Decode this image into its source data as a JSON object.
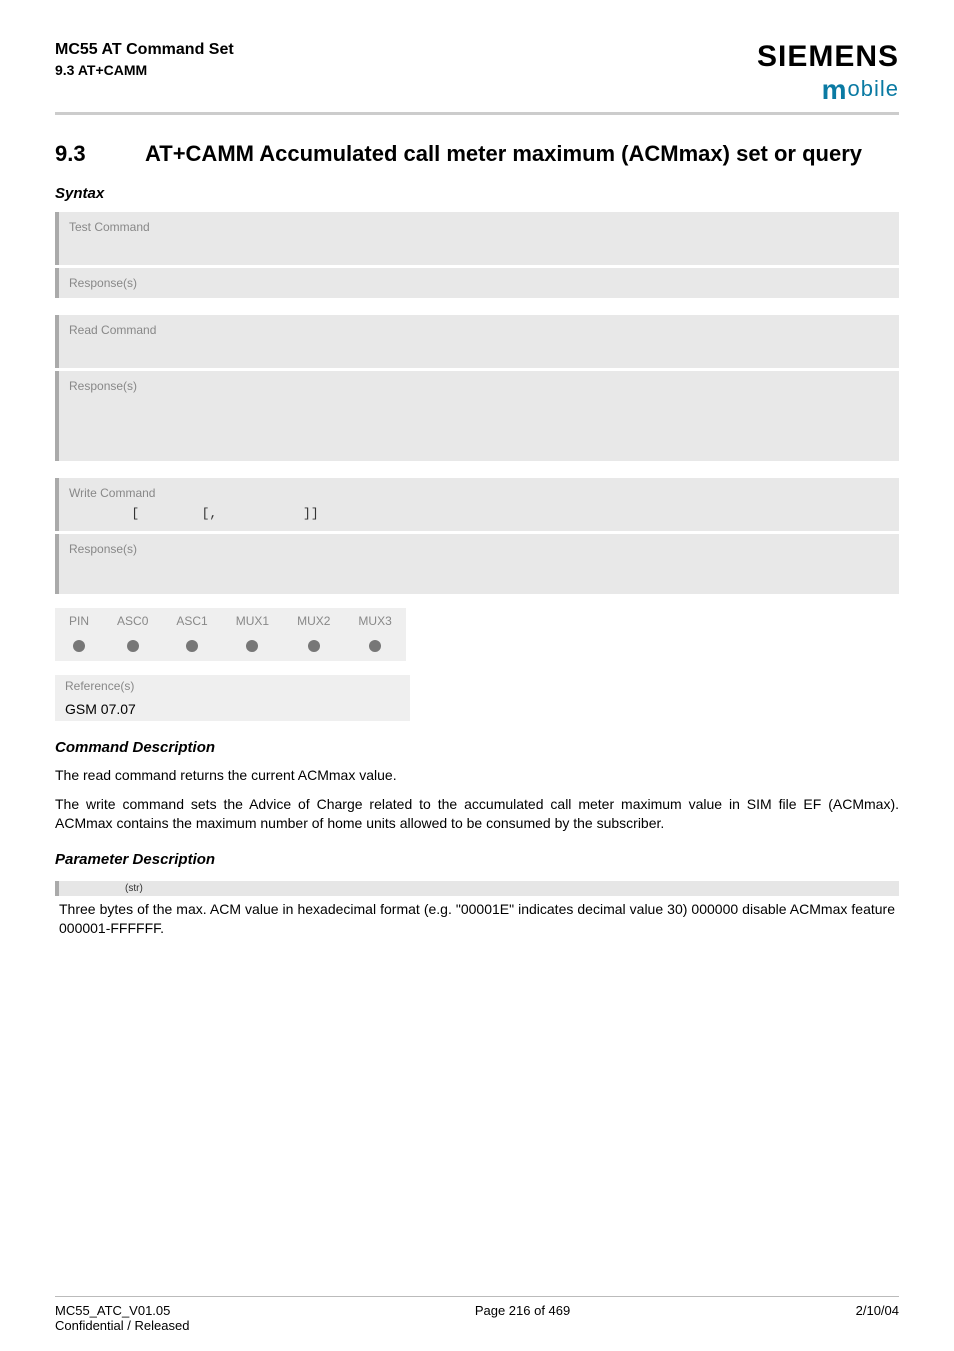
{
  "header": {
    "productLine": "MC55 AT Command Set",
    "sectionRef": "9.3 AT+CAMM",
    "brand": "SIEMENS",
    "brandSub": "obile"
  },
  "section": {
    "number": "9.3",
    "title": "AT+CAMM   Accumulated call meter maximum (ACMmax) set or query"
  },
  "syntaxLabel": "Syntax",
  "blocks": {
    "testLabel": "Test Command",
    "respLabel": "Response(s)",
    "readLabel": "Read Command",
    "writeLabel": "Write Command",
    "writeSyntax": "        [        [,           ]]"
  },
  "pinTable": {
    "cols": [
      "PIN",
      "ASC0",
      "ASC1",
      "MUX1",
      "MUX2",
      "MUX3"
    ]
  },
  "refTable": {
    "head": "Reference(s)",
    "val": "GSM 07.07"
  },
  "cmdDesc": {
    "head": "Command Description",
    "p1": "The read command returns the current ACMmax value.",
    "p2": "The write command sets the Advice of Charge related to the accumulated call meter maximum value in SIM file EF (ACMmax). ACMmax contains the maximum number of home units allowed to be consumed by the subscriber."
  },
  "paramDesc": {
    "head": "Parameter Description",
    "ptype": "(str)",
    "body": "Three bytes of the max. ACM value in hexadecimal format (e.g. \"00001E\" indicates decimal value 30) 000000 disable ACMmax feature 000001-FFFFFF."
  },
  "footer": {
    "leftLine1": "MC55_ATC_V01.05",
    "leftLine2": "Confidential / Released",
    "center": "Page 216 of 469",
    "right": "2/10/04"
  }
}
